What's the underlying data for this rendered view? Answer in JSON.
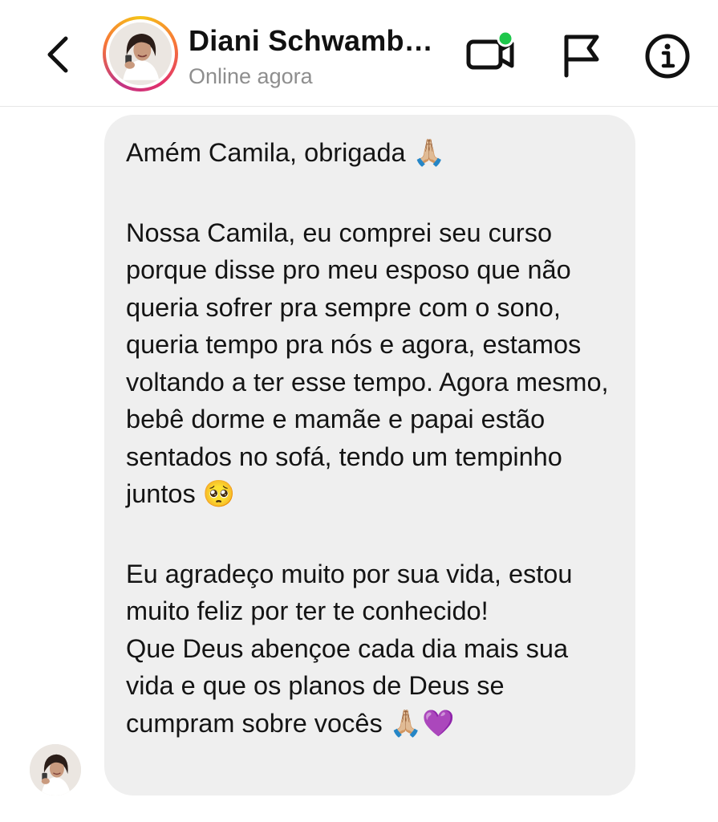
{
  "header": {
    "contact_name": "Diani Schwamb…",
    "status": "Online agora",
    "online_indicator_color": "#1ec74b",
    "icons": {
      "back": "chevron-left-icon",
      "video": "video-call-icon",
      "report": "flag-icon",
      "info": "info-icon"
    }
  },
  "message": {
    "paragraphs": [
      "Amém Camila, obrigada 🙏🏼",
      "Nossa Camila, eu comprei seu curso porque disse pro meu esposo que não queria sofrer pra sempre com o sono, queria tempo pra nós e agora, estamos voltando a ter esse tempo. Agora mesmo, bebê dorme e mamãe e papai estão sentados no sofá, tendo um tempinho juntos 🥺",
      "Eu agradeço muito por sua vida, estou muito feliz por ter te conhecido!\nQue Deus abençoe cada dia mais sua vida e que os planos de Deus se cumpram sobre vocês 🙏🏼💜"
    ]
  },
  "colors": {
    "bubble_background": "#efefef",
    "secondary_text": "#8e8e8e"
  }
}
